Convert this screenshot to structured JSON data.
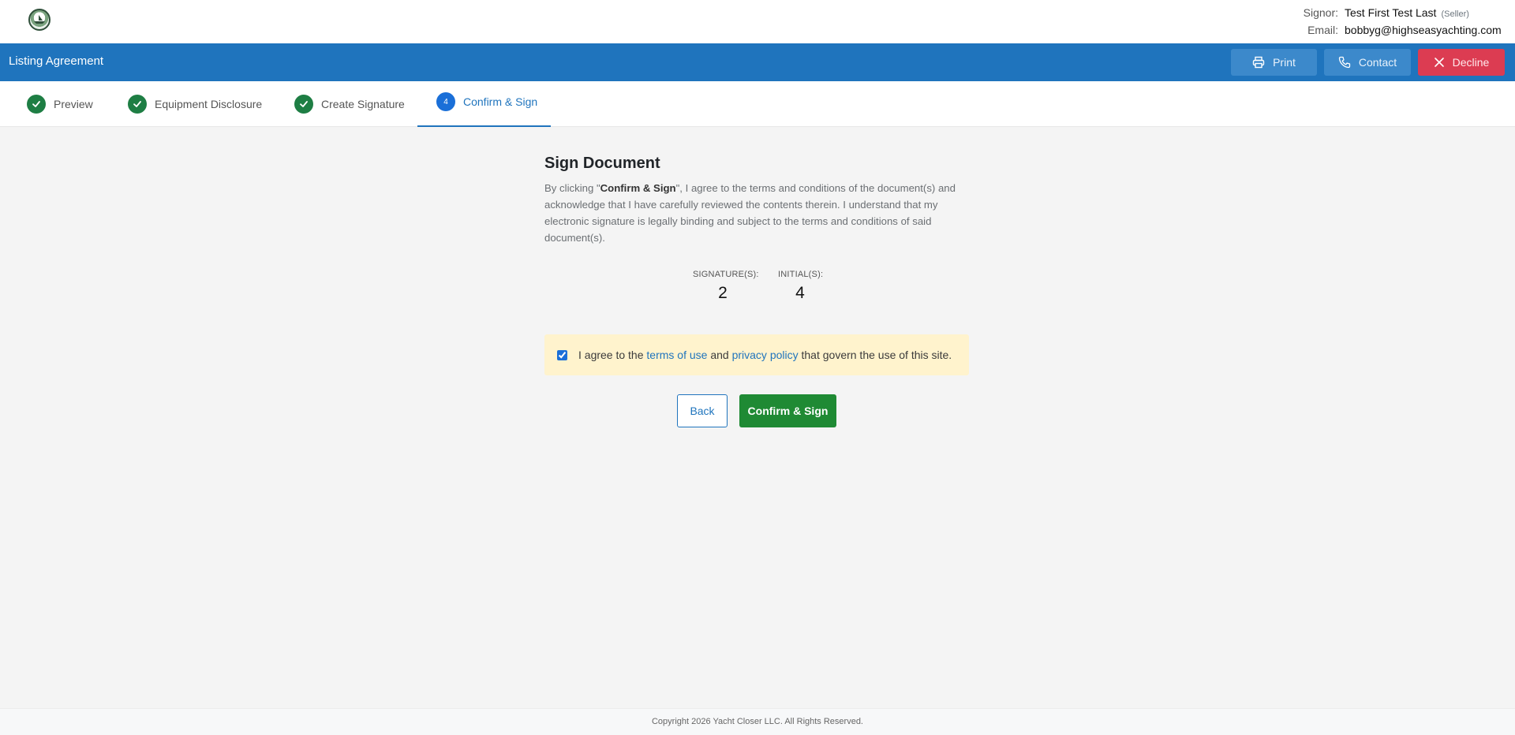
{
  "header": {
    "signor_label": "Signor:",
    "signor_name": "Test First Test Last",
    "signor_role": "(Seller)",
    "email_label": "Email:",
    "email_value": "bobbyg@highseasyachting.com"
  },
  "toolbar": {
    "title": "Listing Agreement",
    "print_label": "Print",
    "contact_label": "Contact",
    "decline_label": "Decline"
  },
  "steps": [
    {
      "label": "Preview",
      "status": "complete"
    },
    {
      "label": "Equipment Disclosure",
      "status": "complete"
    },
    {
      "label": "Create Signature",
      "status": "complete"
    },
    {
      "label": "Confirm & Sign",
      "status": "active",
      "number": "4"
    }
  ],
  "main": {
    "title": "Sign Document",
    "para_prefix": "By clicking \"",
    "para_bold": "Confirm & Sign",
    "para_suffix": "\", I agree to the terms and conditions of the document(s) and acknowledge that I have carefully reviewed the contents therein. I understand that my electronic signature is legally binding and subject to the terms and conditions of said document(s).",
    "signatures_label": "SIGNATURE(S):",
    "signatures_count": "2",
    "initials_label": "INITIAL(S):",
    "initials_count": "4",
    "agree_prefix": "I agree to the ",
    "terms_link": "terms of use",
    "agree_and": " and ",
    "privacy_link": "privacy policy",
    "agree_suffix": " that govern the use of this site.",
    "agree_checked": true,
    "back_label": "Back",
    "confirm_label": "Confirm & Sign"
  },
  "footer": {
    "copyright": "Copyright 2026 Yacht Closer LLC. All Rights Reserved."
  },
  "colors": {
    "brand_blue": "#1f74bd",
    "success_green": "#1f8a34",
    "decline_red": "#dc3c52",
    "notice_yellow": "#fff3cd"
  }
}
